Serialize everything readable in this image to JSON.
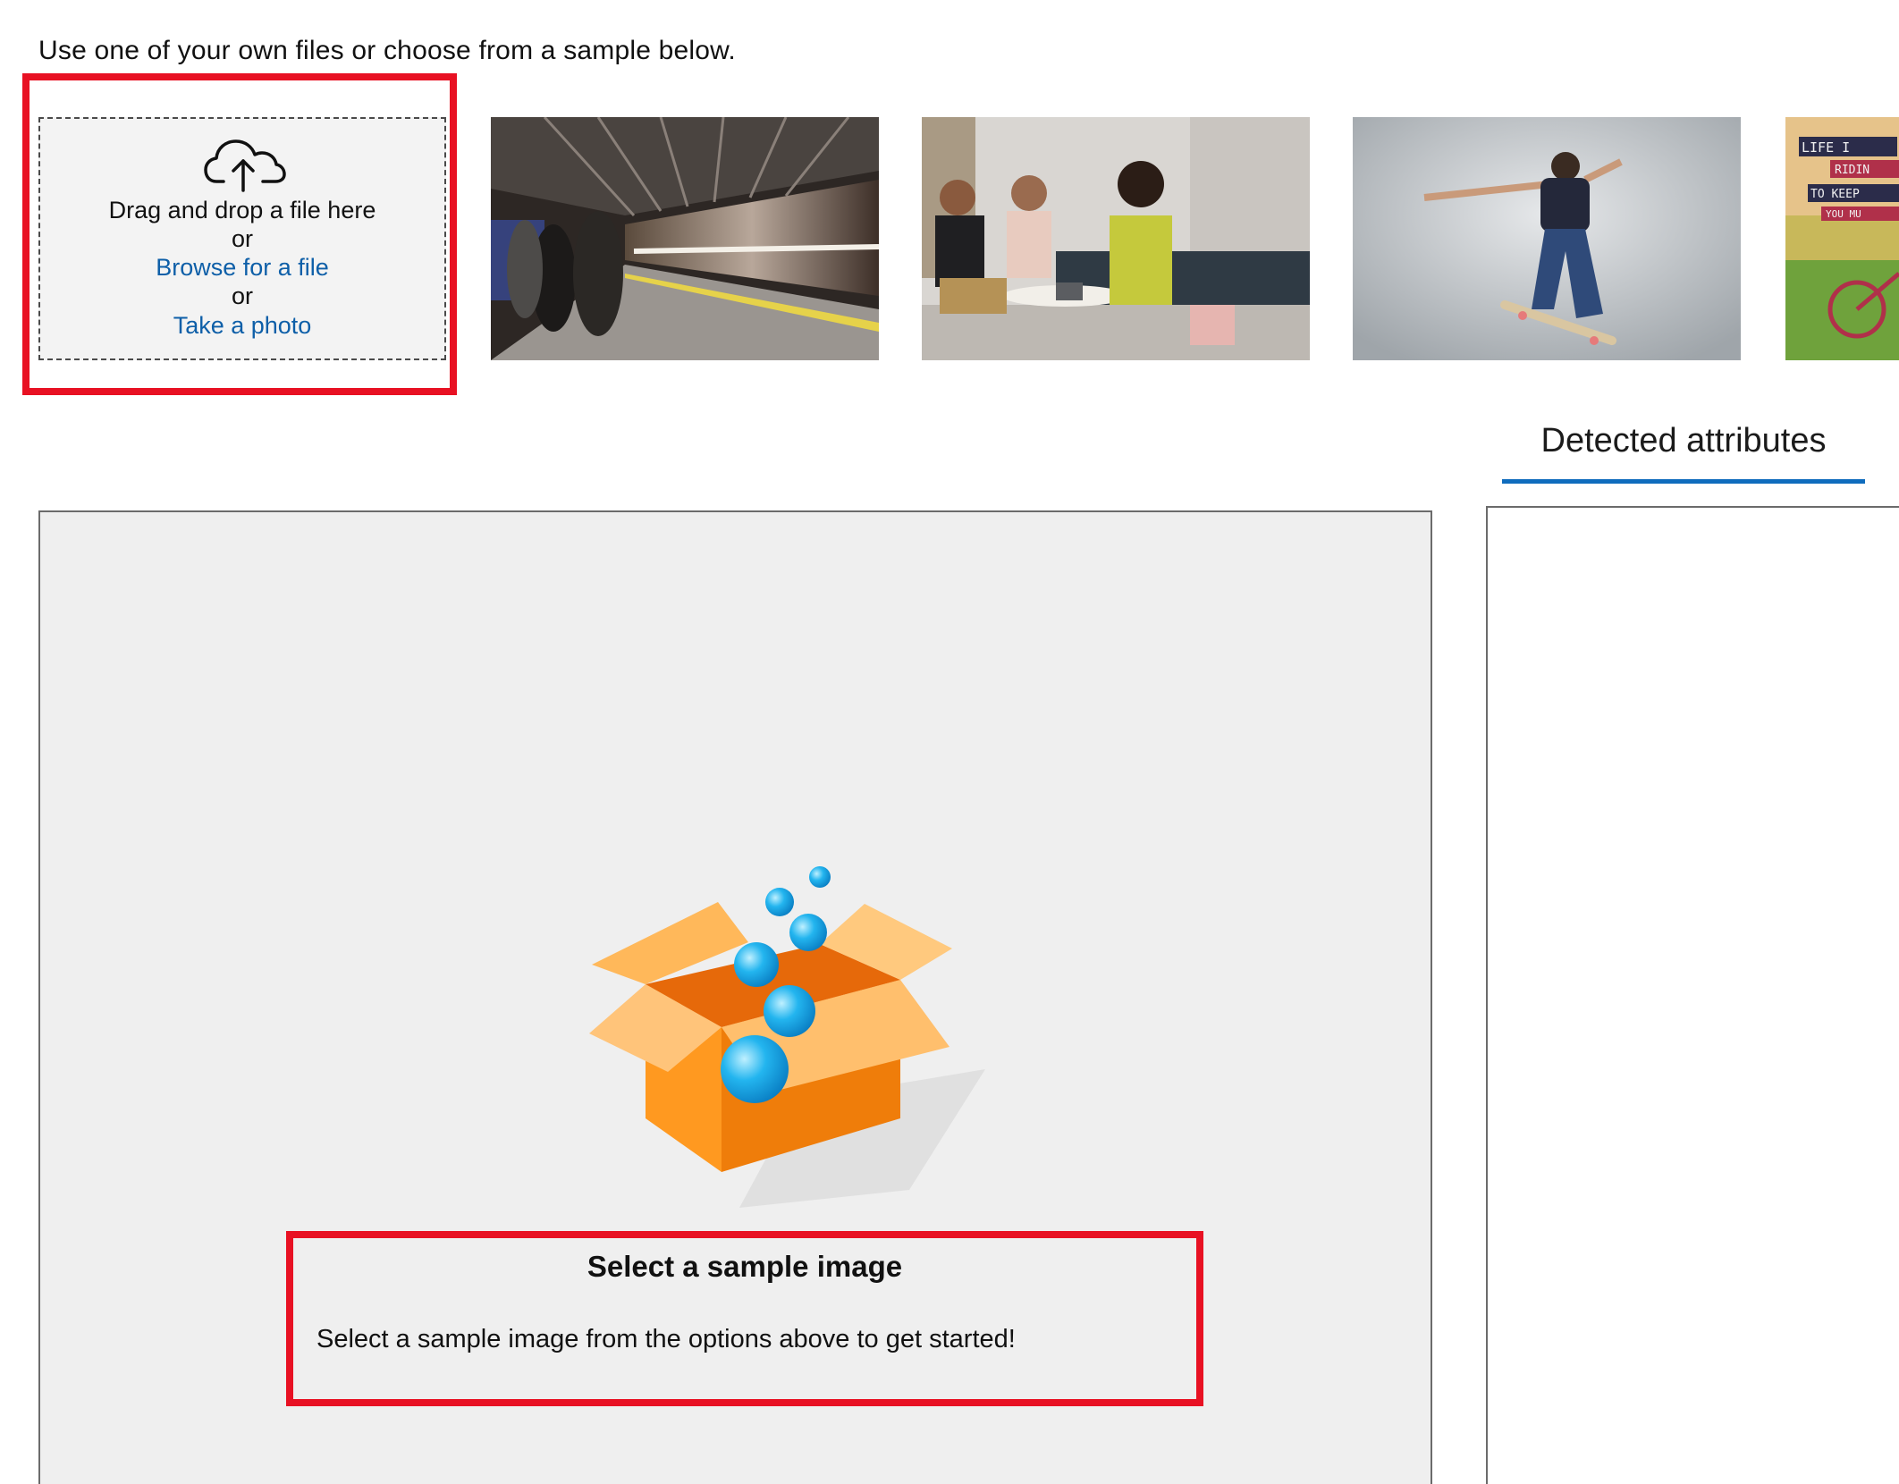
{
  "instruction": "Use one of your own files or choose from a sample below.",
  "upload": {
    "drag_text": "Drag and drop a file here",
    "or_text": "or",
    "browse_link": "Browse for a file",
    "photo_link": "Take a photo",
    "icon": "cloud-upload-icon"
  },
  "samples": [
    {
      "name": "subway-train-sample"
    },
    {
      "name": "people-meeting-sample"
    },
    {
      "name": "skateboarder-sample"
    },
    {
      "name": "life-riding-bicycle-sample",
      "text_lines": [
        "LIFE I",
        "RIDIN",
        "TO KEEP",
        "YOU MU"
      ]
    }
  ],
  "tabs": {
    "detected_attributes": "Detected attributes"
  },
  "main": {
    "illustration": "open-box-with-bubbles",
    "select_title": "Select a sample image",
    "select_description": "Select a sample image from the options above to get started!"
  },
  "colors": {
    "highlight": "#e81123",
    "link": "#0e5fa8",
    "tab_accent": "#0f6cbd",
    "panel_bg": "#efefef"
  }
}
